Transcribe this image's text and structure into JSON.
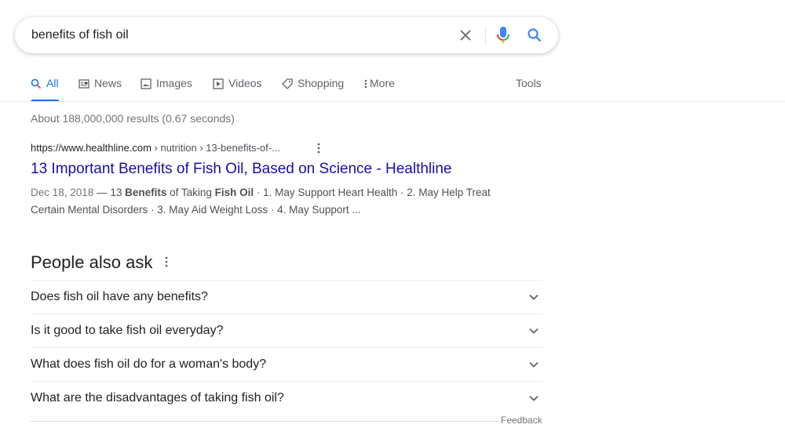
{
  "search": {
    "query": "benefits of fish oil"
  },
  "tabs": [
    {
      "label": "All",
      "icon": "search-icon"
    },
    {
      "label": "News",
      "icon": "news-icon"
    },
    {
      "label": "Images",
      "icon": "image-icon"
    },
    {
      "label": "Videos",
      "icon": "video-icon"
    },
    {
      "label": "Shopping",
      "icon": "tag-icon"
    },
    {
      "label": "More",
      "icon": "vertical-dots-icon"
    }
  ],
  "tools_label": "Tools",
  "stats": "About 188,000,000 results (0.67 seconds)",
  "result": {
    "domain": "https://www.healthline.com",
    "breadcrumb": " › nutrition › 13-benefits-of-...",
    "title": "13 Important Benefits of Fish Oil, Based on Science - Healthline",
    "date": "Dec 18, 2018",
    "snippet_pre": " — 13 ",
    "snippet_b1": "Benefits",
    "snippet_mid": " of Taking ",
    "snippet_b2": "Fish Oil",
    "snippet_post": " · 1. May Support Heart Health · 2. May Help Treat Certain Mental Disorders · 3. May Aid Weight Loss · 4. May Support ..."
  },
  "people_also_ask": {
    "heading": "People also ask",
    "questions": [
      "Does fish oil have any benefits?",
      "Is it good to take fish oil everyday?",
      "What does fish oil do for a woman's body?",
      "What are the disadvantages of taking fish oil?"
    ]
  },
  "feedback_label": "Feedback",
  "colors": {
    "link_title": "#1a0dab",
    "accent_blue": "#1a73e8",
    "mic_red": "#ea4335"
  }
}
